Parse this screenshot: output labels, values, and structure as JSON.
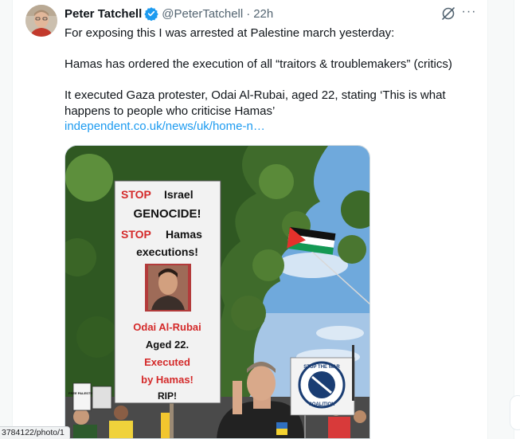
{
  "tweet": {
    "author_name": "Peter Tatchell",
    "handle": "@PeterTatchell",
    "separator": "·",
    "time": "22h",
    "more_icon": "···",
    "lines": [
      "For exposing this I was arrested at Palestine march yesterday:",
      "Hamas has ordered the execution of all “traitors & troublemakers” (critics)",
      "It executed Gaza protester, Odai Al-Rubai, aged 22, stating ‘This is what happens to people who criticise Hamas’"
    ],
    "link_text": "independent.co.uk/news/uk/home-n…"
  },
  "media": {
    "placard": {
      "line1_stop": "STOP",
      "line1_rest": "Israel",
      "line2": "GENOCIDE!",
      "line3_stop": "STOP",
      "line3_rest": "Hamas",
      "line4": "executions!",
      "name": "Odai Al-Rubai",
      "age": "Aged 22.",
      "executed": "Executed",
      "by": "by Hamas!",
      "rip": "RIP!"
    },
    "stw_top": "STOP THE WAR",
    "stw_bottom": "COALITION",
    "left_sign": "FREE PALESTINE"
  },
  "status_bar": {
    "url": "3784122/photo/1"
  },
  "colors": {
    "link": "#1d9bf0",
    "verified": "#1d9bf0",
    "placard_red": "#d42a2a",
    "sky": "#6fa9dc"
  },
  "icons": [
    "verified-badge-icon",
    "grok-icon",
    "more-options-icon"
  ]
}
